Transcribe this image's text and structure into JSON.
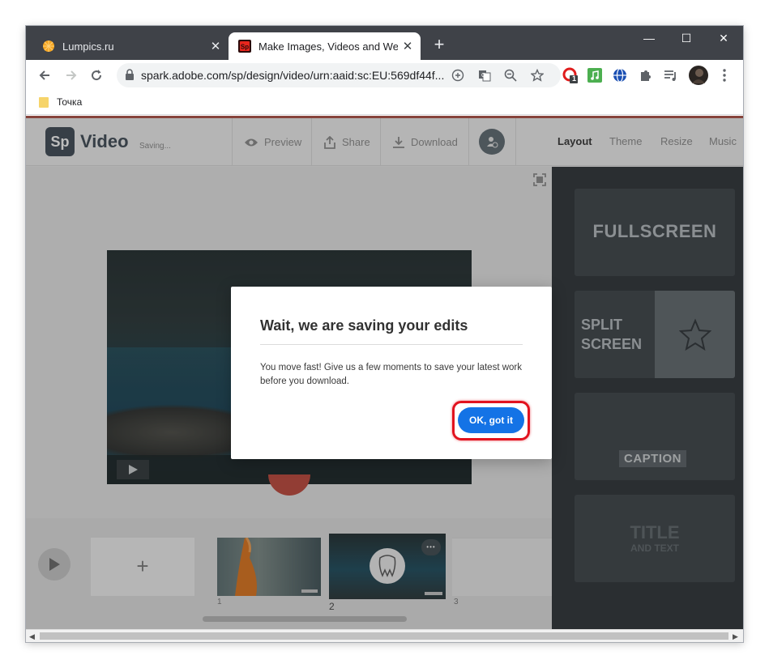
{
  "browser": {
    "tabs": [
      {
        "title": "Lumpics.ru",
        "close": "✕"
      },
      {
        "title": "Make Images, Videos and Web S",
        "close": "✕"
      }
    ],
    "new_tab": "+",
    "window_controls": {
      "minimize": "—",
      "maximize": "☐",
      "close": "✕"
    },
    "url": "spark.adobe.com/sp/design/video/urn:aaid:sc:EU:569df44f...",
    "extension_badge": "1",
    "bookmarks": [
      {
        "label": "Точка"
      }
    ]
  },
  "app": {
    "logo": "Sp",
    "name": "Video",
    "status": "Saving...",
    "header_buttons": {
      "preview": "Preview",
      "share": "Share",
      "download": "Download"
    },
    "right_tabs": [
      {
        "label": "Layout",
        "active": true
      },
      {
        "label": "Theme",
        "active": false
      },
      {
        "label": "Resize",
        "active": false
      },
      {
        "label": "Music",
        "active": false
      }
    ],
    "layouts": {
      "fullscreen": "FULLSCREEN",
      "split_line1": "SPLIT",
      "split_line2": "SCREEN",
      "caption": "CAPTION",
      "title": "TITLE",
      "title_sub": "AND TEXT"
    },
    "timeline": {
      "add": "+",
      "slide_numbers": [
        "1",
        "2",
        "3"
      ],
      "more": "•••"
    }
  },
  "modal": {
    "title": "Wait, we are saving your edits",
    "body": "You move fast! Give us a few moments to save your latest work before you download.",
    "ok_label": "OK, got it"
  },
  "colors": {
    "accent_button": "#1473e6",
    "highlight_ring": "#e2131f",
    "sidebar_bg": "#2b3135",
    "header_accent": "#b05045"
  }
}
